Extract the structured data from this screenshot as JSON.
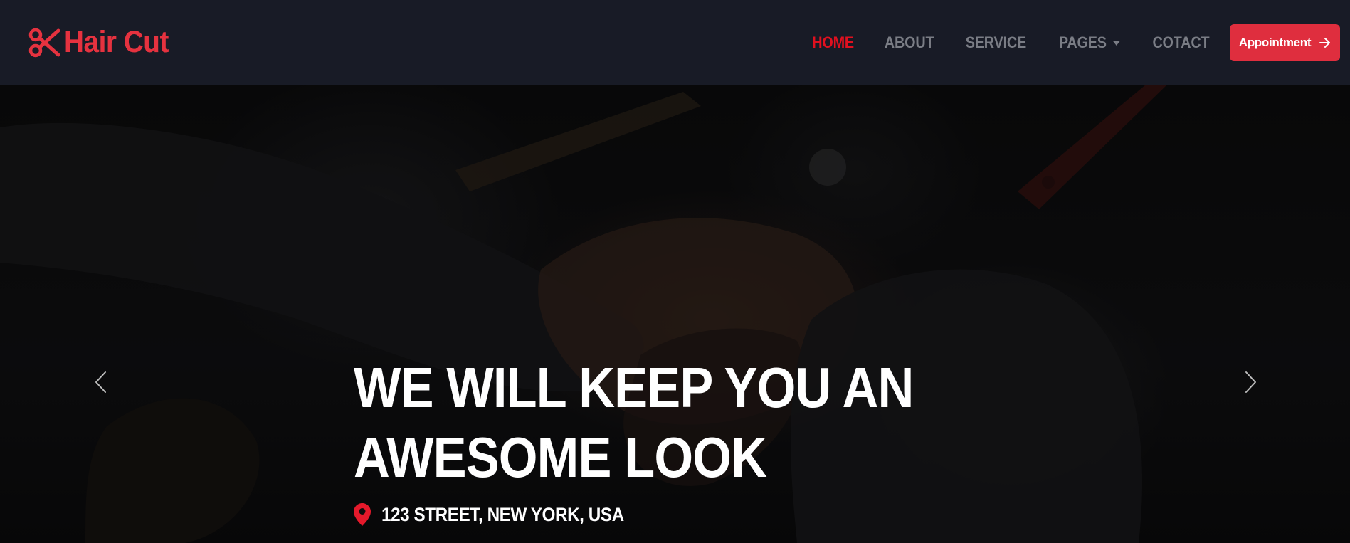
{
  "brand": {
    "name": "Hair Cut",
    "icon": "scissors-icon",
    "color": "#e5323f"
  },
  "nav": {
    "items": [
      {
        "label": "HOME",
        "active": true
      },
      {
        "label": "ABOUT",
        "active": false
      },
      {
        "label": "SERVICE",
        "active": false
      },
      {
        "label": "PAGES",
        "active": false,
        "dropdown": true
      },
      {
        "label": "COTACT",
        "active": false
      }
    ],
    "button": {
      "label": "Appointment",
      "icon": "arrow-right-icon"
    }
  },
  "hero": {
    "title_line1": "WE WILL KEEP YOU AN",
    "title_line2": "AWESOME LOOK",
    "address": "123 STREET, NEW YORK, USA",
    "address_icon": "map-pin-icon",
    "prev_icon": "chevron-left-icon",
    "next_icon": "chevron-right-icon"
  },
  "colors": {
    "navbar_bg": "#181b26",
    "accent": "#df2e3e",
    "active_link": "#e0101f",
    "nav_link": "#7a7d85"
  }
}
